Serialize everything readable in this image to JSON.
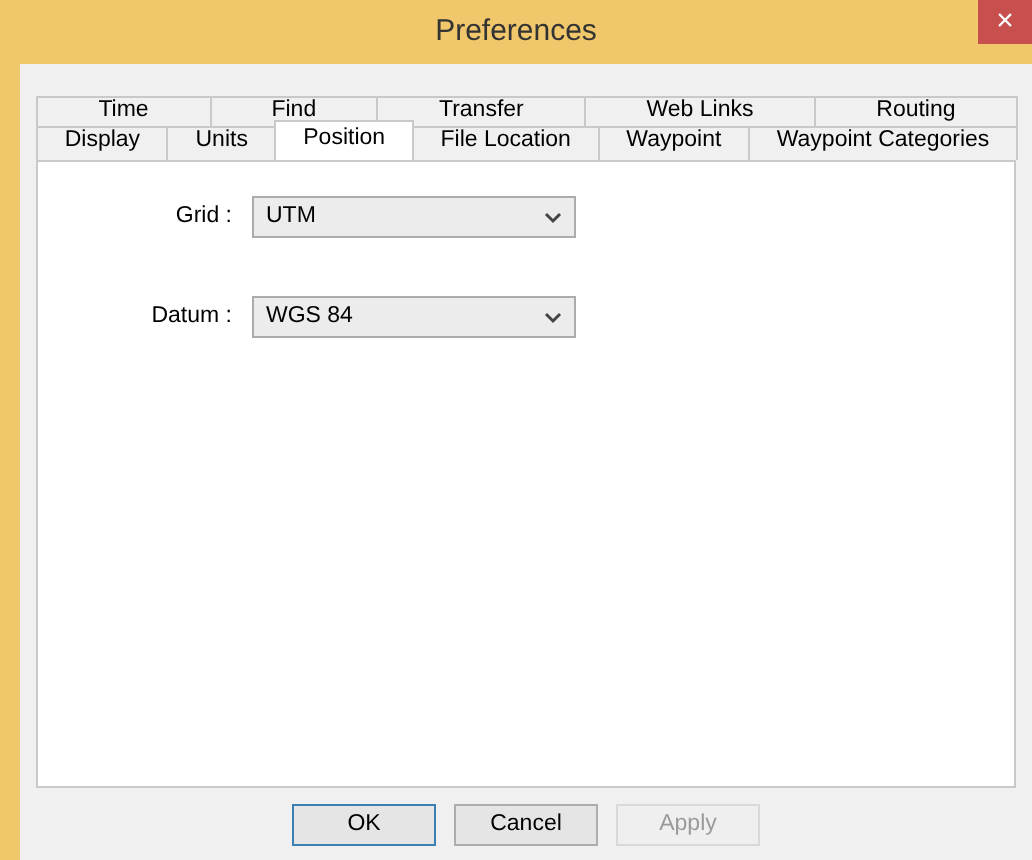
{
  "window": {
    "title": "Preferences",
    "close": "×"
  },
  "tab_rows": [
    [
      {
        "label": "Time",
        "selected": false
      },
      {
        "label": "Find",
        "selected": false
      },
      {
        "label": "Transfer",
        "selected": false
      },
      {
        "label": "Web Links",
        "selected": false
      },
      {
        "label": "Routing",
        "selected": false
      }
    ],
    [
      {
        "label": "Display",
        "selected": false
      },
      {
        "label": "Units",
        "selected": false
      },
      {
        "label": "Position",
        "selected": true
      },
      {
        "label": "File Location",
        "selected": false
      },
      {
        "label": "Waypoint",
        "selected": false
      },
      {
        "label": "Waypoint Categories",
        "selected": false
      }
    ]
  ],
  "fields": [
    {
      "label": "Grid :",
      "value": "UTM"
    },
    {
      "label": "Datum :",
      "value": "WGS 84"
    }
  ],
  "buttons": [
    {
      "label": "OK",
      "default": true,
      "disabled": false
    },
    {
      "label": "Cancel",
      "default": false,
      "disabled": false
    },
    {
      "label": "Apply",
      "default": false,
      "disabled": true
    }
  ]
}
